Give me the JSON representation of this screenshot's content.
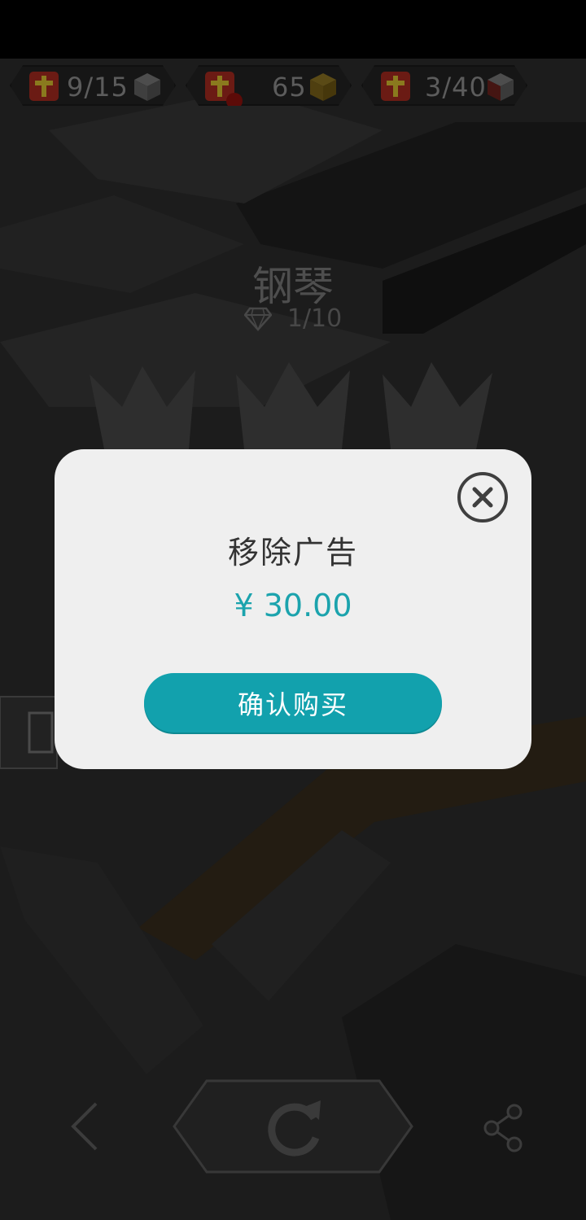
{
  "hud": [
    {
      "icon": "red-cross-icon",
      "text": "9/15",
      "cube": "white-cube-icon"
    },
    {
      "icon": "red-cross-icon",
      "text": "65",
      "cube": "gold-cube-icon"
    },
    {
      "icon": "red-cross-icon",
      "text": "3/40",
      "cube": "red-white-cube-icon"
    }
  ],
  "level": {
    "title": "钢琴",
    "progress": "1/10"
  },
  "dialog": {
    "title": "移除广告",
    "price": "¥ 30.00",
    "confirm_label": "确认购买"
  },
  "colors": {
    "accent": "#12a1ad",
    "price": "#1ba3ad",
    "dialog_bg": "#efefef",
    "dim_bg": "#1b1b1b"
  },
  "icons": {
    "close": "close-icon",
    "back": "chevron-left-icon",
    "retry": "refresh-icon",
    "share": "share-icon"
  }
}
